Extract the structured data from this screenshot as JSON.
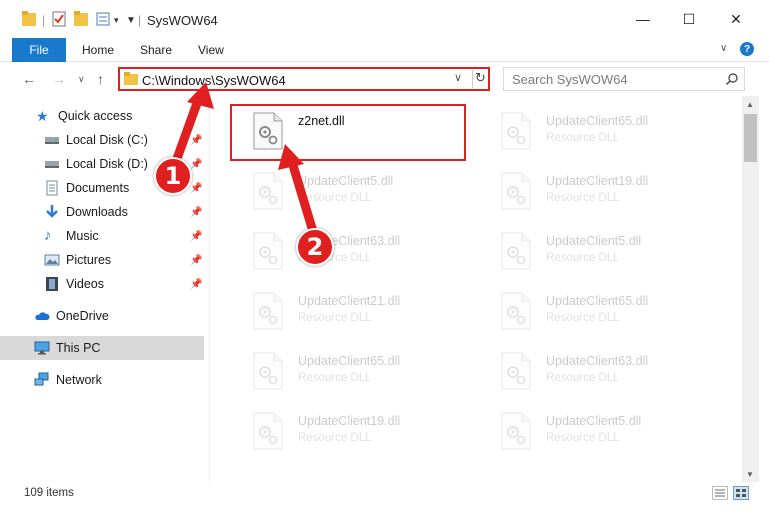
{
  "window": {
    "title": "SysWOW64",
    "minimize_glyph": "—",
    "maximize_glyph": "☐",
    "close_glyph": "✕"
  },
  "ribbon": {
    "tabs": [
      "File",
      "Home",
      "Share",
      "View"
    ]
  },
  "address": {
    "path": "C:\\Windows\\SysWOW64",
    "search_placeholder": "Search SysWOW64"
  },
  "sidebar": {
    "items": [
      {
        "label": "Quick access",
        "icon": "star-icon",
        "pinned": false
      },
      {
        "label": "Local Disk (C:)",
        "icon": "drive-icon",
        "pinned": true
      },
      {
        "label": "Local Disk (D:)",
        "icon": "drive-icon",
        "pinned": true
      },
      {
        "label": "Documents",
        "icon": "documents-icon",
        "pinned": true
      },
      {
        "label": "Downloads",
        "icon": "download-arrow-icon",
        "pinned": true
      },
      {
        "label": "Music",
        "icon": "music-note-icon",
        "pinned": true
      },
      {
        "label": "Pictures",
        "icon": "pictures-icon",
        "pinned": true
      },
      {
        "label": "Videos",
        "icon": "film-icon",
        "pinned": true
      },
      {
        "label": "OneDrive",
        "icon": "cloud-icon",
        "pinned": false
      },
      {
        "label": "This PC",
        "icon": "monitor-icon",
        "pinned": false,
        "selected": true
      },
      {
        "label": "Network",
        "icon": "network-icon",
        "pinned": false
      }
    ]
  },
  "files": [
    {
      "name": "z2net.dll",
      "type": ""
    },
    {
      "name": "UpdateClient65.dll",
      "type": "Resource DLL"
    },
    {
      "name": "UpdateClient5.dll",
      "type": "Resource DLL"
    },
    {
      "name": "UpdateClient19.dll",
      "type": "Resource DLL"
    },
    {
      "name": "UpdateClient63.dll",
      "type": "Resource DLL"
    },
    {
      "name": "UpdateClient5.dll",
      "type": "Resource DLL"
    },
    {
      "name": "UpdateClient21.dll",
      "type": "Resource DLL"
    },
    {
      "name": "UpdateClient65.dll",
      "type": "Resource DLL"
    },
    {
      "name": "UpdateClient65.dll",
      "type": "Resource DLL"
    },
    {
      "name": "UpdateClient63.dll",
      "type": "Resource DLL"
    },
    {
      "name": "UpdateClient19.dll",
      "type": "Resource DLL"
    },
    {
      "name": "UpdateClient5.dll",
      "type": "Resource DLL"
    }
  ],
  "status": {
    "item_count": "109 items"
  },
  "callouts": [
    "1",
    "2"
  ],
  "colors": {
    "accent": "#1979ca",
    "annotation": "#e02020",
    "folder": "#f3c443"
  }
}
